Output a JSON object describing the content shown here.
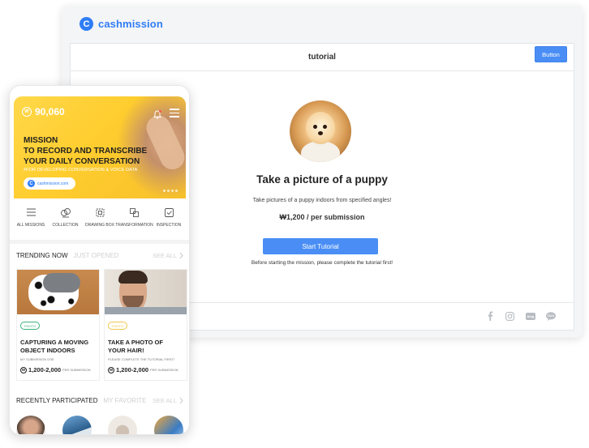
{
  "desktop": {
    "brand": "cashmission",
    "brand_mark": "C",
    "header_title": "tutorial",
    "header_button": "Button",
    "mission": {
      "title": "Take a picture of a puppy",
      "description": "Take pictures of a puppy indoors from specified angles!",
      "price": "₩1,200 / per submission",
      "start_button": "Start Tutorial",
      "note": "Before starting the mission, please complete the tutorial first!"
    },
    "social_icons": [
      "facebook-icon",
      "instagram-icon",
      "blog-icon",
      "talk-icon"
    ]
  },
  "phone": {
    "balance_symbol": "W",
    "balance": "90,060",
    "hero": {
      "title": "MISSION\nTO RECORD AND TRANSCRIBE\nYOUR DAILY CONVERSATION",
      "subtitle": "#FOR DEVELOPING CONVERSATION & VOICE DATA",
      "pill_mark": "C",
      "pill_text": "cashmission.com"
    },
    "categories": [
      {
        "label": "ALL MISSIONS",
        "icon": "list-icon"
      },
      {
        "label": "COLLECTION",
        "icon": "collection-icon"
      },
      {
        "label": "DRAWING BOX",
        "icon": "drawing-box-icon"
      },
      {
        "label": "TRANSFORMATION",
        "icon": "transformation-icon"
      },
      {
        "label": "INSPECTION",
        "icon": "inspection-icon"
      }
    ],
    "trending": {
      "tab_active": "TRENDING NOW",
      "tab_inactive": "JUST OPENED",
      "see_all": "SEE ALL"
    },
    "cards": [
      {
        "tag": "PHOTO",
        "title": "CAPTURING A MOVING\nOBJECT INDOORS",
        "sub": "MY SUBMISSION 0/35",
        "price_symbol": "W",
        "price": "1,200-2,000",
        "unit": "PER SUBMISSION"
      },
      {
        "tag": "PHOTO",
        "title": "TAKE A PHOTO OF\nYOUR HAIR!",
        "sub": "PLEASE COMPLETE THE TUTORIAL FIRST!",
        "price_symbol": "W",
        "price": "1,200-2,000",
        "unit": "PER SUBMISSION"
      }
    ],
    "recent": {
      "tab_active": "RECENTLY PARTICIPATED",
      "tab_inactive": "MY FAVORITE",
      "see_all": "SEE ALL"
    }
  }
}
